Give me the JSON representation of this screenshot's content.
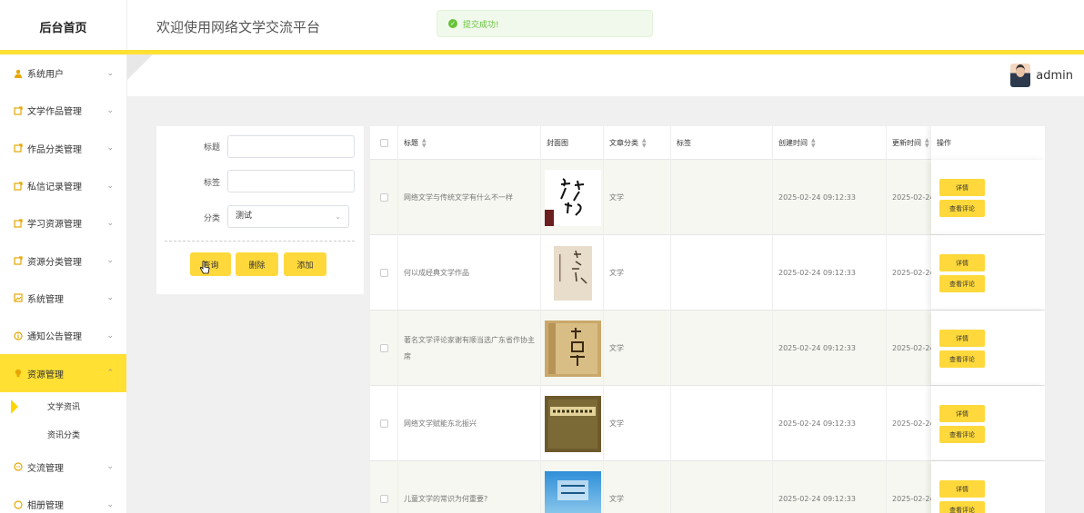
{
  "header": {
    "brand": "后台首页",
    "welcome": "欢迎使用网络文学交流平台",
    "toast": "提交成功!"
  },
  "user": {
    "name": "admin"
  },
  "sidebar": {
    "items": [
      {
        "label": "系统用户",
        "icon": "user-icon"
      },
      {
        "label": "文学作品管理",
        "icon": "share-icon"
      },
      {
        "label": "作品分类管理",
        "icon": "share-icon"
      },
      {
        "label": "私信记录管理",
        "icon": "share-icon"
      },
      {
        "label": "学习资源管理",
        "icon": "share-icon"
      },
      {
        "label": "资源分类管理",
        "icon": "share-icon"
      },
      {
        "label": "系统管理",
        "icon": "picture-icon"
      },
      {
        "label": "通知公告管理",
        "icon": "info-icon"
      },
      {
        "label": "资源管理",
        "icon": "bulb-icon",
        "active": true
      }
    ],
    "sub_items": [
      "文学资讯",
      "资讯分类"
    ],
    "items_after": [
      {
        "label": "交流管理",
        "icon": "chat-icon"
      },
      {
        "label": "相册管理",
        "icon": "chat-icon"
      }
    ]
  },
  "search": {
    "title_label": "标题",
    "title_value": "",
    "tag_label": "标签",
    "tag_value": "",
    "category_label": "分类",
    "category_value": "测试",
    "query_button": "查询",
    "delete_button": "删除",
    "add_button": "添加"
  },
  "table": {
    "headers": {
      "title": "标题",
      "cover": "封面图",
      "category": "文章分类",
      "tag": "标签",
      "created": "创建时间",
      "updated": "更新时间",
      "actions": "操作"
    },
    "rows": [
      {
        "title": "网络文学与传统文学有什么不一样",
        "category": "文学",
        "tag": "",
        "created": "2025-02-24 09:12:33",
        "updated": "2025-02-24"
      },
      {
        "title": "何以成经典文学作品",
        "category": "文学",
        "tag": "",
        "created": "2025-02-24 09:12:33",
        "updated": "2025-02-24"
      },
      {
        "title": "著名文学评论家谢有顺当选广东省作协主席",
        "category": "文学",
        "tag": "",
        "created": "2025-02-24 09:12:33",
        "updated": "2025-02-24"
      },
      {
        "title": "网络文学赋能东北振兴",
        "category": "文学",
        "tag": "",
        "created": "2025-02-24 09:12:33",
        "updated": "2025-02-24"
      },
      {
        "title": "儿童文学的常识为何重要?",
        "category": "文学",
        "tag": "",
        "created": "2025-02-24 09:12:33",
        "updated": "2025-02-24"
      }
    ],
    "detail_button": "详情",
    "comments_button": "查看评论"
  },
  "colors": {
    "accent": "#ffe033",
    "button": "#ffd93b",
    "success": "#67c23a"
  }
}
